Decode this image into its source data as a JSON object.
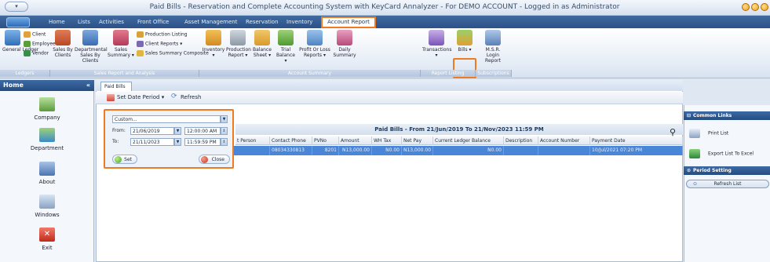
{
  "window": {
    "title": "Paid Bills - Reservation and Complete Accounting System with KeyCard Annalyzer - For DEMO ACCOUNT - Logged in as Administrator"
  },
  "menu_tabs": [
    "Home",
    "Lists",
    "Activities",
    "Front Office",
    "Asset Management",
    "Reservation",
    "Inventory",
    "Account Report"
  ],
  "ribbon": {
    "general_ledger": "General Ledger",
    "client": "Client",
    "employee": "Employee",
    "vendor": "Vendor",
    "sales_by_clients": "Sales By Clients",
    "departmental_sales_by_clients": "Departmental Sales By Clients",
    "sales_summary": "Sales Summary ▾",
    "production_listing": "Production Listing",
    "client_reports": "Client Reports ▾",
    "sales_summary_composite": "Sales Summary Composite",
    "inventory": "Inventory ▾",
    "production_report": "Production Report ▾",
    "balance_sheet": "Balance Sheet ▾",
    "trial_balance": "Trial Balance ▾",
    "profit_or_loss": "Profit Or Loss Reports ▾",
    "daily_summary": "Daily Summary",
    "transactions": "Transactions ▾",
    "bills": "Bills ▾",
    "msr_login_report": "M.S.R. Login Report",
    "groups": [
      "Ledgers",
      "Sales Report and Analysis",
      "Account Summary",
      "Report Listing",
      "Subscriptions"
    ]
  },
  "left_panel": {
    "header": "Home",
    "collapse": "«",
    "items": [
      "Company",
      "Department",
      "About",
      "Windows",
      "Exit"
    ]
  },
  "document": {
    "tab": "Paid Bills",
    "set_date_period": "Set Date Period ▾",
    "refresh": "Refresh",
    "grid_title": "Paid Bills - From 21/Jun/2019 To 21/Nov/2023 11:59 PM",
    "columns": [
      "t Person",
      "Contact Phone",
      "PVNo",
      "Amount",
      "WH Tax",
      "Net Pay",
      "Current Ledger Balance",
      "Description",
      "Account Number",
      "Payment Date"
    ],
    "rows": [
      [
        "",
        "08034330813",
        "8201",
        "N13,000.00",
        "N0.00",
        "N13,000.00",
        "N0.00",
        "",
        "",
        "10/Jul/2021 07:20 PM"
      ]
    ]
  },
  "date_filter": {
    "period": "Custom...",
    "from_label": "From:",
    "from_date": "21/06/2019",
    "from_time": "12:00:00 AM",
    "to_label": "To:",
    "to_date": "21/11/2023",
    "to_time": "11:59:59 PM",
    "set": "Set",
    "close": "Close"
  },
  "right_panel": {
    "common_links": "Common Links",
    "print_list": "Print List",
    "export_excel": "Export List To Excel",
    "period_setting": "Period Setting",
    "refresh_list": "Refresh List"
  },
  "colors": {
    "accent": "#ee7a22",
    "header": "#2c5287",
    "selected_row": "#4a86d8"
  }
}
